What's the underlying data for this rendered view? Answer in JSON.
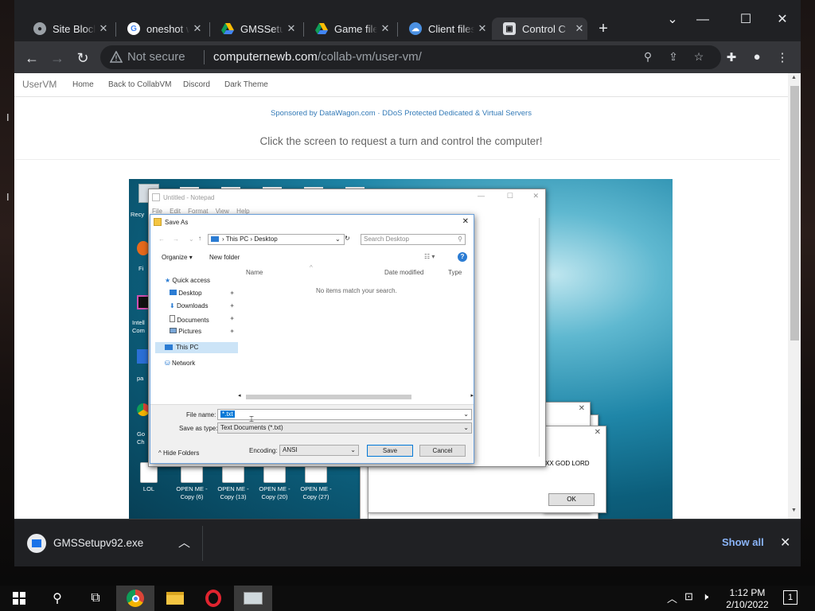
{
  "browser": {
    "tabs": [
      {
        "title": "Site Blocke",
        "active": false,
        "favicon": "globe-icon"
      },
      {
        "title": "oneshot w",
        "active": false,
        "favicon": "google-icon"
      },
      {
        "title": "GMSSetu",
        "active": false,
        "favicon": "google-drive-icon"
      },
      {
        "title": "Game file",
        "active": false,
        "favicon": "google-drive-icon"
      },
      {
        "title": "Client files",
        "active": false,
        "favicon": "cloud-icon"
      },
      {
        "title": "Control C",
        "active": true,
        "favicon": "collabvm-icon"
      }
    ],
    "address": {
      "security_label": "Not secure",
      "host": "computernewb.com",
      "path": "/collab-vm/user-vm/"
    }
  },
  "site": {
    "brand": "UserVM",
    "nav": [
      "Home",
      "Back to CollabVM",
      "Discord",
      "Dark Theme"
    ],
    "sponsor": "Sponsored by DataWagon.com · DDoS Protected Dedicated & Virtual Servers",
    "instruction": "Click the screen to request a turn and control the computer!"
  },
  "vm": {
    "desktop_icons": [
      {
        "label": "LOL"
      },
      {
        "label": "OPEN ME - Copy (6)"
      },
      {
        "label": "OPEN ME - Copy (13)"
      },
      {
        "label": "OPEN ME - Copy (20)"
      },
      {
        "label": "OPEN ME - Copy (27)"
      }
    ],
    "desktop_left_stubs": [
      "Recy",
      "Fi",
      "Intell Com",
      "pa",
      "Go Ch"
    ],
    "message_box": {
      "text": "XX GOD LORD",
      "ok_label": "OK"
    },
    "notepad": {
      "title": "Untitled - Notepad",
      "menu": [
        "File",
        "Edit",
        "Format",
        "View",
        "Help"
      ]
    },
    "save_as": {
      "title": "Save As",
      "breadcrumb": [
        "This PC",
        "Desktop"
      ],
      "search_placeholder": "Search Desktop",
      "organize_label": "Organize",
      "new_folder_label": "New folder",
      "columns": [
        "Name",
        "Date modified",
        "Type"
      ],
      "empty_message": "No items match your search.",
      "nav_items": [
        {
          "label": "Quick access",
          "icon": "star-icon"
        },
        {
          "label": "Desktop",
          "icon": "desktop-icon"
        },
        {
          "label": "Downloads",
          "icon": "download-icon"
        },
        {
          "label": "Documents",
          "icon": "documents-icon"
        },
        {
          "label": "Pictures",
          "icon": "pictures-icon"
        },
        {
          "label": "This PC",
          "icon": "computer-icon"
        },
        {
          "label": "Network",
          "icon": "network-icon"
        }
      ],
      "file_name_label": "File name:",
      "file_name_value": "*.txt",
      "save_as_type_label": "Save as type:",
      "save_as_type_value": "Text Documents (*.txt)",
      "hide_folders_label": "Hide Folders",
      "encoding_label": "Encoding:",
      "encoding_value": "ANSI",
      "save_label": "Save",
      "cancel_label": "Cancel"
    }
  },
  "downloads": {
    "file": "GMSSetupv92.exe",
    "show_all": "Show all"
  },
  "taskbar": {
    "time": "1:12 PM",
    "date": "2/10/2022",
    "notification_count": "1"
  },
  "colors": {
    "chrome_dark": "#202124",
    "chrome_toolbar": "#35363a",
    "link_blue": "#8ab4f8",
    "taskbar": "#0d0d0d"
  }
}
